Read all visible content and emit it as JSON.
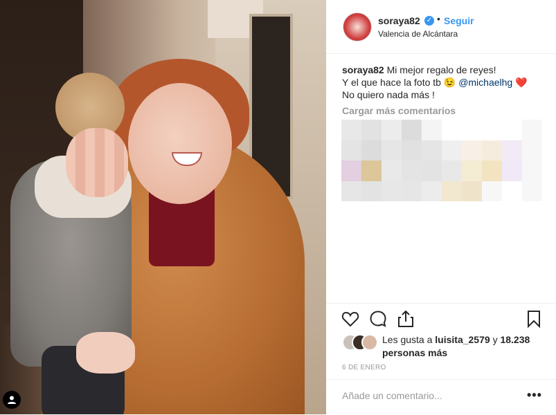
{
  "post": {
    "username": "soraya82",
    "follow_label": "Seguir",
    "separator": "•",
    "location": "Valencia de Alcántara",
    "caption_line1": "Mi mejor regalo de reyes!",
    "caption_line2_prefix": "Y el que hace la foto tb",
    "wink_emoji": "😉",
    "mention": "@michaelhg",
    "heart_emoji": "❤️",
    "caption_line3": "No quiero nada más !",
    "load_more": "Cargar más comentarios",
    "likes_prefix": "Les gusta a",
    "likes_user": "luisita_2579",
    "likes_mid": "y",
    "likes_count": "18.238 personas más",
    "date": "6 DE ENERO",
    "comment_placeholder": "Añade un comentario...",
    "more_options": "•••"
  },
  "icons": {
    "like": "heart-outline-icon",
    "comment": "speech-bubble-icon",
    "share": "share-icon",
    "save": "bookmark-icon",
    "verified": "verified-badge-icon",
    "user": "user-icon"
  },
  "colors": {
    "accent": "#3897f0",
    "mention": "#003569",
    "muted": "#999999",
    "text": "#262626"
  }
}
